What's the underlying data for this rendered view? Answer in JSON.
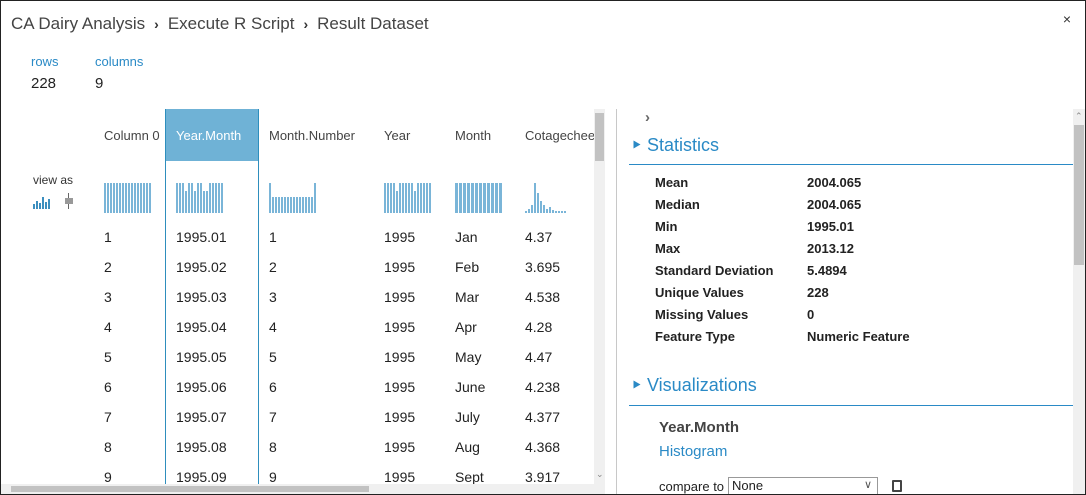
{
  "breadcrumb": [
    "CA Dairy Analysis",
    "Execute R Script",
    "Result Dataset"
  ],
  "breadcrumb_separator": "›",
  "close_icon": "×",
  "summary": {
    "rows_label": "rows",
    "rows_value": "228",
    "columns_label": "columns",
    "columns_value": "9"
  },
  "view_as_label": "view as",
  "columns": [
    {
      "header": "Column 0",
      "selected": false,
      "cells": [
        "1",
        "2",
        "3",
        "4",
        "5",
        "6",
        "7",
        "8",
        "9"
      ],
      "hist": [
        30,
        30,
        30,
        30,
        30,
        30,
        30,
        30,
        30,
        30,
        30,
        30,
        30,
        30,
        30,
        30
      ]
    },
    {
      "header": "Year.Month",
      "selected": true,
      "cells": [
        "1995.01",
        "1995.02",
        "1995.03",
        "1995.04",
        "1995.05",
        "1995.06",
        "1995.07",
        "1995.08",
        "1995.09"
      ],
      "hist": [
        30,
        30,
        30,
        22,
        30,
        30,
        22,
        30,
        30,
        22,
        22,
        30,
        30,
        30,
        30,
        30
      ]
    },
    {
      "header": "Month.Number",
      "selected": false,
      "cells": [
        "1",
        "2",
        "3",
        "4",
        "5",
        "6",
        "7",
        "8",
        "9"
      ],
      "hist": [
        30,
        16,
        16,
        16,
        16,
        16,
        16,
        16,
        16,
        16,
        16,
        16,
        16,
        16,
        16,
        30
      ]
    },
    {
      "header": "Year",
      "selected": false,
      "cells": [
        "1995",
        "1995",
        "1995",
        "1995",
        "1995",
        "1995",
        "1995",
        "1995",
        "1995"
      ],
      "hist": [
        30,
        30,
        30,
        30,
        22,
        30,
        30,
        30,
        30,
        30,
        22,
        30,
        30,
        30,
        30,
        30
      ]
    },
    {
      "header": "Month",
      "selected": false,
      "cells": [
        "Jan",
        "Feb",
        "Mar",
        "Apr",
        "May",
        "June",
        "July",
        "Aug",
        "Sept"
      ],
      "hist": [
        30,
        30,
        30,
        30,
        30,
        30,
        30,
        30,
        30,
        30,
        30,
        30
      ]
    },
    {
      "header": "Cotagechee",
      "selected": false,
      "cells": [
        "4.37",
        "3.695",
        "4.538",
        "4.28",
        "4.47",
        "4.238",
        "4.377",
        "4.368",
        "3.917"
      ],
      "hist": [
        2,
        4,
        8,
        30,
        20,
        12,
        8,
        4,
        6,
        3,
        2,
        2,
        2,
        2
      ]
    }
  ],
  "stats_section_title": "Statistics",
  "statistics": [
    {
      "label": "Mean",
      "value": "2004.065"
    },
    {
      "label": "Median",
      "value": "2004.065"
    },
    {
      "label": "Min",
      "value": "1995.01"
    },
    {
      "label": "Max",
      "value": "2013.12"
    },
    {
      "label": "Standard Deviation",
      "value": "5.4894"
    },
    {
      "label": "Unique Values",
      "value": "228"
    },
    {
      "label": "Missing Values",
      "value": "0"
    },
    {
      "label": "Feature Type",
      "value": "Numeric Feature"
    }
  ],
  "vis_section_title": "Visualizations",
  "vis_column_name": "Year.Month",
  "vis_type": "Histogram",
  "compare_label": "compare to",
  "compare_value": "None",
  "icons": {
    "histogram_view": "histogram-icon",
    "boxplot_view": "boxplot-icon",
    "copy": "copy-icon",
    "collapse": "chevron-right-icon"
  },
  "colors": {
    "accent": "#2a8ac6",
    "selected_header": "#6fb2d6",
    "hist_bar": "#7ab5d8"
  }
}
